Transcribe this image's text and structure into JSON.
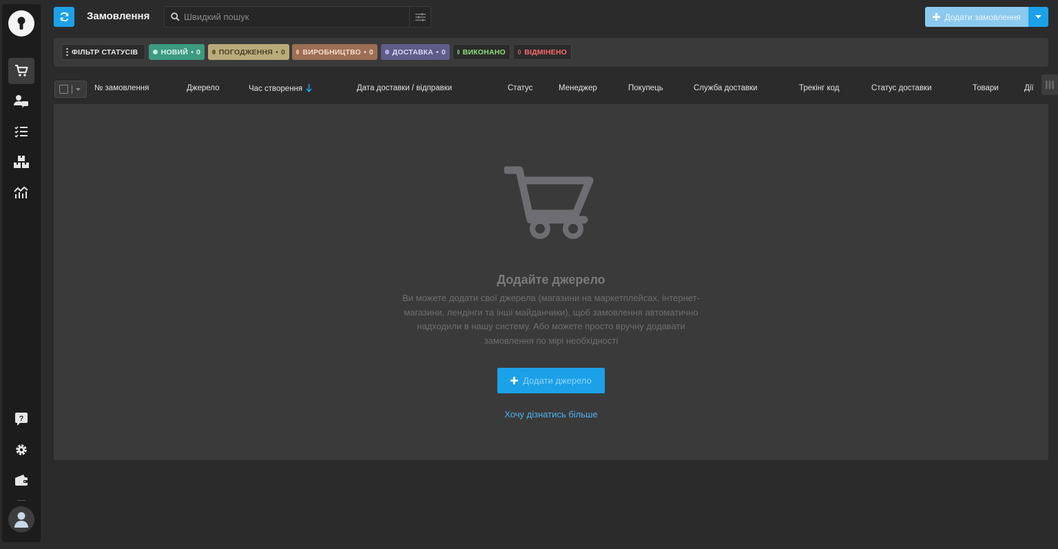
{
  "app": {
    "accent_color": "#1ba1e8"
  },
  "sidebar": {
    "logo_icon": "keyhole-icon",
    "items": [
      {
        "name": "orders",
        "icon": "cart-icon",
        "active": true
      },
      {
        "name": "clients",
        "icon": "user-chat-icon",
        "active": false
      },
      {
        "name": "tasks",
        "icon": "checklist-icon",
        "active": false
      },
      {
        "name": "products",
        "icon": "boxes-icon",
        "active": false
      },
      {
        "name": "analytics",
        "icon": "chart-icon",
        "active": false
      }
    ],
    "bottom_items": [
      {
        "name": "help",
        "icon": "help-icon"
      },
      {
        "name": "settings",
        "icon": "gear-icon"
      },
      {
        "name": "wallet",
        "icon": "wallet-icon"
      }
    ],
    "profile_icon": "user-avatar-icon"
  },
  "header": {
    "refresh_icon": "refresh-icon",
    "title": "Замовлення",
    "search_placeholder": "Швидкий пошук",
    "filter_icon": "sliders-icon",
    "add_order_label": "Додати замовлення"
  },
  "status_filter": {
    "label": "ФІЛЬТР СТАТУСІВ",
    "statuses": [
      {
        "label": "НОВИЙ",
        "count": "0",
        "color": "#3c9a80"
      },
      {
        "label": "ПОГОДЖЕННЯ",
        "count": "0",
        "color": "#b9ac7a"
      },
      {
        "label": "ВИРОБНИЦТВО",
        "count": "0",
        "color": "#9c6f55"
      },
      {
        "label": "ДОСТАВКА",
        "count": "0",
        "color": "#5f5d88"
      },
      {
        "label": "ВИКОНАНО",
        "color": "#8ee07a"
      },
      {
        "label": "ВІДМІНЕНО",
        "color": "#ff6b6b"
      }
    ]
  },
  "table": {
    "columns": [
      "№ замовлення",
      "Джерело",
      "Час створення",
      "Дата доставки / відправки",
      "Статус",
      "Менеджер",
      "Покупець",
      "Служба доставки",
      "Трекінг код",
      "Статус доставки",
      "Товари",
      "Дії"
    ],
    "sorted_column": "Час створення",
    "sort_direction": "desc"
  },
  "empty_state": {
    "icon": "cart-icon",
    "title": "Додайте джерело",
    "description": "Ви можете додати свої джерела (магазини на маркетплейсах, інтернет-магазини, лендінги та інші майданчики), щоб замовлення автоматично надходили в нашу систему. Або можете просто вручну додавати замовлення по мірі необхідності",
    "add_button": "Додати джерело",
    "learn_more": "Хочу дізнатись більше"
  }
}
